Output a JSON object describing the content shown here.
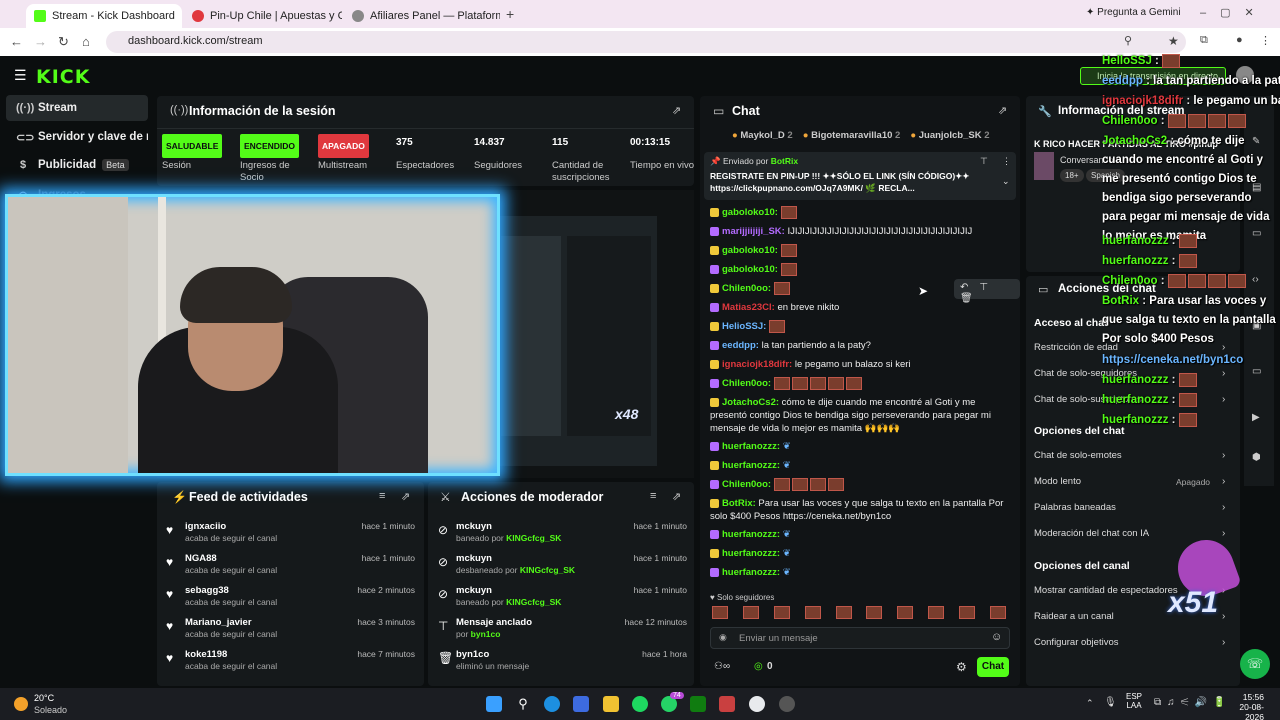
{
  "tabs": [
    {
      "label": "Stream - Kick Dashboard",
      "fav": "#53fc18"
    },
    {
      "label": "Pin-Up Chile | Apuestas y Casin",
      "fav": "#e0383e"
    },
    {
      "label": "Afiliares Panel — Plataforma de",
      "fav": "#888888"
    }
  ],
  "gemini": "Pregunta a Gemini",
  "url": "dashboard.kick.com/stream",
  "logo": "KICK",
  "sidebar": {
    "items": [
      {
        "label": "Stream",
        "icon": "signal-icon"
      },
      {
        "label": "Servidor y clave de retran",
        "icon": "link-icon"
      },
      {
        "label": "Publicidad",
        "icon": "dollar-icon",
        "beta": "Beta"
      },
      {
        "label": "Ingresos",
        "icon": "coin-icon"
      }
    ]
  },
  "session": {
    "title": "Información de la sesión",
    "stats": [
      {
        "value": "SALUDABLE",
        "label": "Sesión",
        "badge": "#53fc18",
        "fg": "#0b0e0f"
      },
      {
        "value": "ENCENDIDO",
        "label": "Ingresos de Socio",
        "badge": "#53fc18",
        "fg": "#0b0e0f"
      },
      {
        "value": "APAGADO",
        "label": "Multistream",
        "badge": "#e0383e",
        "fg": "#ffffff"
      },
      {
        "value": "375",
        "label": "Espectadores"
      },
      {
        "value": "14.837",
        "label": "Seguidores"
      },
      {
        "value": "115",
        "label": "Cantidad de suscripciones"
      },
      {
        "value": "00:13:15",
        "label": "Tiempo en vivo"
      }
    ]
  },
  "cam_overlay": "x48",
  "feed": {
    "title": "Feed de actividades",
    "items": [
      {
        "name": "ignxaciio",
        "sub": "acaba de seguir el canal",
        "time": "hace 1 minuto"
      },
      {
        "name": "NGA88",
        "sub": "acaba de seguir el canal",
        "time": "hace 1 minuto"
      },
      {
        "name": "sebagg38",
        "sub": "acaba de seguir el canal",
        "time": "hace 2 minutos"
      },
      {
        "name": "Mariano_javier",
        "sub": "acaba de seguir el canal",
        "time": "hace 3 minutos"
      },
      {
        "name": "koke1198",
        "sub": "acaba de seguir el canal",
        "time": "hace 7 minutos"
      }
    ]
  },
  "mod": {
    "title": "Acciones de moderador",
    "items": [
      {
        "icon": "ban-icon",
        "name": "mckuyn",
        "sub": "baneado por ",
        "who": "KINGcfcg_SK",
        "time": "hace 1 minuto"
      },
      {
        "icon": "ban-icon",
        "name": "mckuyn",
        "sub": "desbaneado por ",
        "who": "KINGcfcg_SK",
        "time": "hace 1 minuto"
      },
      {
        "icon": "ban-icon",
        "name": "mckuyn",
        "sub": "baneado por ",
        "who": "KINGcfcg_SK",
        "time": "hace 1 minuto"
      },
      {
        "icon": "pin-icon",
        "name": "Mensaje anclado",
        "sub": "por ",
        "who": "byn1co",
        "time": "hace 12 minutos"
      },
      {
        "icon": "trash-icon",
        "name": "byn1co",
        "sub": "eliminó un mensaje",
        "who": "",
        "time": "hace 1 hora"
      }
    ]
  },
  "chat": {
    "title": "Chat",
    "top_gifters": [
      {
        "name": "Maykol_D",
        "n": "2"
      },
      {
        "name": "Bigotemaravilla10",
        "n": "2"
      },
      {
        "name": "JuanjoIcb_SK",
        "n": "2"
      }
    ],
    "pinned_by": "Enviado por",
    "pinned_user": "BotRix",
    "pinned_text": "REGISTRATE EN PIN-UP !!! ✦✦SÓLO EL LINK (SÍN CÓDIGO)✦✦ https://clickpupnano.com/OJq7A9MK/ 🌿 RECLA...",
    "messages": [
      {
        "user": "gaboloko10:",
        "color": "#53fc18",
        "text": "",
        "emotes": 1
      },
      {
        "user": "marijjiijiji_SK:",
        "color": "#b36bff",
        "text": "IJIJIJIJIJIJIJIJIJIJIJIJIJIJIJIJIJIJIJIJIJIJIJIJIJ",
        "emotes": 0
      },
      {
        "user": "gaboloko10:",
        "color": "#53fc18",
        "text": "",
        "emotes": 1
      },
      {
        "user": "gaboloko10:",
        "color": "#53fc18",
        "text": "",
        "emotes": 1
      },
      {
        "user": "Chilen0oo:",
        "color": "#53fc18",
        "text": "",
        "emotes": 1
      },
      {
        "user": "Matias23Cl:",
        "color": "#e0383e",
        "text": "en breve nikito",
        "emotes": 0
      },
      {
        "user": "HelioSSJ:",
        "color": "#6bb6ff",
        "text": "",
        "emotes": 1
      },
      {
        "user": "eeddpp:",
        "color": "#6bb6ff",
        "text": "la tan partiendo a la paty?",
        "emotes": 0
      },
      {
        "user": "ignaciojk18difr:",
        "color": "#e0383e",
        "text": "le pegamo un balazo si keri",
        "emotes": 0
      },
      {
        "user": "Chilen0oo:",
        "color": "#53fc18",
        "text": "",
        "emotes": 5
      },
      {
        "user": "JotachoCs2:",
        "color": "#53fc18",
        "text": "cómo te dije cuando me encontré al Goti y me presentó contigo Dios te bendiga sigo perseverando para pegar mi mensaje de vida lo mejor es mamita 🙌🙌🙌",
        "emotes": 0,
        "wrap": true
      },
      {
        "user": "huerfanozzz:",
        "color": "#53fc18",
        "text": "",
        "emotes": 0
      },
      {
        "user": "huerfanozzz:",
        "color": "#53fc18",
        "text": "",
        "emotes": 0
      },
      {
        "user": "Chilen0oo:",
        "color": "#53fc18",
        "text": "",
        "emotes": 4
      },
      {
        "user": "BotRix:",
        "color": "#53fc18",
        "text": "Para usar las voces y que salga tu texto en la pantalla Por solo $400 Pesos https://ceneka.net/byn1co",
        "emotes": 0,
        "wrap": true
      },
      {
        "user": "huerfanozzz:",
        "color": "#53fc18",
        "text": "",
        "emotes": 0
      },
      {
        "user": "huerfanozzz:",
        "color": "#53fc18",
        "text": "",
        "emotes": 0
      },
      {
        "user": "huerfanozzz:",
        "color": "#53fc18",
        "text": "",
        "emotes": 0
      }
    ],
    "followers_only": "Solo seguidores",
    "placeholder": "Enviar un mensaje",
    "count": "0",
    "send": "Chat"
  },
  "right": {
    "info_title": "Información del stream",
    "stream_title": "K RICO HACER PARTIDAS AL TIRO #pinup",
    "category": "Conversando",
    "tag1": "18+",
    "tag2": "Spanish",
    "actions_title": "Acciones del chat",
    "chat_access": "Acceso al chat",
    "items_a": [
      "Restricción de edad",
      "Chat de solo-seguidores",
      "Chat de solo-suscriptores"
    ],
    "chat_options": "Opciones del chat",
    "items_b": [
      "Chat de solo-emotes",
      "Modo lento",
      "Palabras baneadas",
      "Moderación del chat con IA"
    ],
    "slow_val": "Apagado",
    "channel_options": "Opciones del canal",
    "items_c": [
      "Mostrar cantidad de espectadores",
      "Raidear a un canal",
      "Configurar objetivos"
    ]
  },
  "overlay": [
    {
      "user": "HelloSSJ",
      "text": "",
      "color": "#53fc18"
    },
    {
      "user": "eeddpp",
      "text": "la tan partiendo a la paty?",
      "color": "#6bb6ff"
    },
    {
      "user": "ignaciojk18difr",
      "text": "le pegamo un balazo si keri",
      "color": "#e0383e"
    },
    {
      "user": "Chilen0oo",
      "text": "",
      "color": "#53fc18"
    },
    {
      "user": "JotachoCs2",
      "text": "cómo te dije cuando me encontré al Goti y me presentó contigo Dios te bendiga sigo perseverando para pegar mi mensaje de vida lo mejor es mamita",
      "color": "#53fc18"
    },
    {
      "user": "huerfanozzz",
      "text": "",
      "color": "#53fc18"
    },
    {
      "user": "huerfanozzz",
      "text": "",
      "color": "#53fc18"
    },
    {
      "user": "Chilen0oo",
      "text": "",
      "color": "#53fc18"
    },
    {
      "user": "BotRix",
      "text": "Para usar las voces y que salga tu texto en la pantalla Por solo $400 Pesos",
      "color": "#53fc18"
    },
    {
      "user": "",
      "text": "https://ceneka.net/byn1co",
      "color": "#6bb6ff"
    },
    {
      "user": "huerfanozzz",
      "text": "",
      "color": "#53fc18"
    },
    {
      "user": "huerfanozzz",
      "text": "",
      "color": "#53fc18"
    },
    {
      "user": "huerfanozzz",
      "text": "",
      "color": "#53fc18"
    }
  ],
  "overlay_misc": {
    "banner": "Inicia la transmisión en directo",
    "combo": "x51"
  },
  "taskbar": {
    "temp": "20°C",
    "weather": "Soleado",
    "lang1": "ESP",
    "lang2": "LAA",
    "time": "15:56",
    "date": "20-08-2026",
    "badge": "74"
  }
}
